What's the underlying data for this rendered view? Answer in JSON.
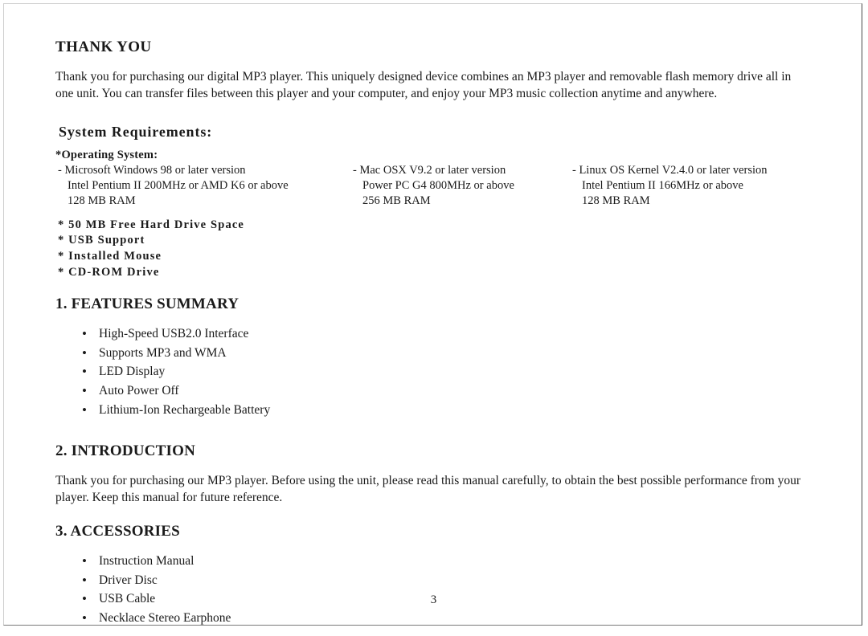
{
  "page": {
    "number": "3"
  },
  "thank_you": {
    "heading": "THANK YOU",
    "paragraph": "Thank you for purchasing our digital MP3 player. This uniquely designed device combines an MP3 player and removable flash memory drive all in one unit. You can transfer files between this player and your computer, and enjoy your MP3 music collection anytime and anywhere."
  },
  "system_requirements": {
    "heading": "System Requirements:",
    "os_label": "*Operating System:",
    "os_columns": [
      {
        "line1": "- Microsoft Windows 98 or later version",
        "line2": "Intel Pentium II 200MHz or AMD K6 or above",
        "line3": "128 MB RAM"
      },
      {
        "line1": "- Mac OSX V9.2 or later version",
        "line2": "Power PC G4 800MHz or above",
        "line3": "256 MB RAM"
      },
      {
        "line1": "- Linux OS Kernel V2.4.0 or later version",
        "line2": "Intel Pentium II 166MHz or above",
        "line3": "128 MB RAM"
      }
    ],
    "other_requirements": [
      "* 50 MB Free Hard Drive Space",
      "* USB Support",
      "* Installed Mouse",
      "* CD-ROM Drive"
    ]
  },
  "features_summary": {
    "heading": "1. FEATURES SUMMARY",
    "items": [
      "High-Speed USB2.0 Interface",
      "Supports MP3 and WMA",
      "LED Display",
      "Auto Power Off",
      "Lithium-Ion Rechargeable Battery"
    ]
  },
  "introduction": {
    "heading": "2. INTRODUCTION",
    "paragraph": "Thank you for purchasing our MP3 player. Before using the unit, please read this manual carefully, to obtain the best possible performance from your player. Keep this manual for future reference."
  },
  "accessories": {
    "heading": "3. ACCESSORIES",
    "items": [
      "Instruction Manual",
      "Driver Disc",
      "USB Cable",
      "Necklace Stereo Earphone"
    ]
  }
}
